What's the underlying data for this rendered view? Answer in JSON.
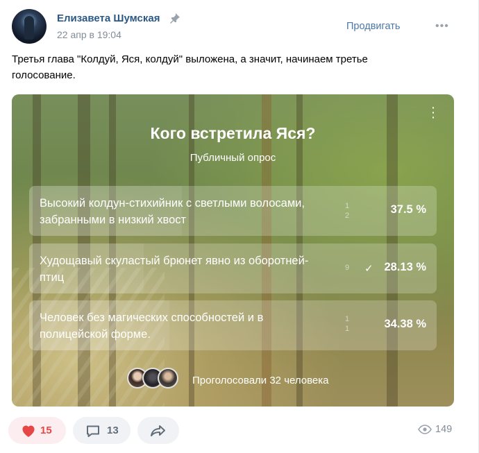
{
  "post": {
    "author": "Елизавета Шумская",
    "date": "22 апр в 19:04",
    "promote_label": "Продвигать",
    "more_label": "•••",
    "text": "Третья глава \"Колдуй, Яся, колдуй\" выложена, а значит, начинаем третье голосование."
  },
  "poll": {
    "title": "Кого встретила Яся?",
    "subtitle": "Публичный опрос",
    "options": [
      {
        "text": "Высокий колдун-стихийник с светлыми волосами, забранными в низкий хвост",
        "votes_line1": "1",
        "votes_line2": "2",
        "percent": "37.5 %",
        "voted": false,
        "fraction": 0.375
      },
      {
        "text": "Худощавый скуластый брюнет явно из оборотней-птиц",
        "votes_line1": "9",
        "votes_line2": "",
        "percent": "28.13 %",
        "voted": true,
        "fraction": 0.2813
      },
      {
        "text": "Человек без магических способностей и в полицейской форме.",
        "votes_line1": "1",
        "votes_line2": "1",
        "percent": "34.38 %",
        "voted": false,
        "fraction": 0.3438
      }
    ],
    "voted_text": "Проголосовали 32 человека",
    "check_mark": "✓"
  },
  "footer": {
    "likes": "15",
    "comments": "13",
    "views": "149"
  },
  "colors": {
    "link": "#2a5885",
    "accent": "#4a76a8",
    "like": "#e64646",
    "muted": "#818c99"
  }
}
